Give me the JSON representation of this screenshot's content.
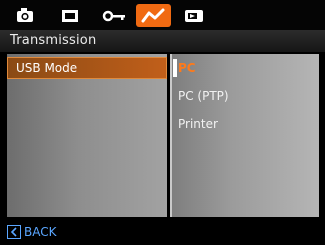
{
  "tabs": [
    {
      "icon": "camera-icon",
      "active": false
    },
    {
      "icon": "memory-card-icon",
      "active": false
    },
    {
      "icon": "key-icon",
      "active": false
    },
    {
      "icon": "connection-icon",
      "active": true
    },
    {
      "icon": "playback-icon",
      "active": false
    }
  ],
  "section": {
    "title": "Transmission"
  },
  "menu": {
    "items": [
      {
        "label": "USB Mode",
        "selected": true
      }
    ]
  },
  "options": {
    "items": [
      {
        "label": "PC",
        "selected": true
      },
      {
        "label": "PC (PTP)",
        "selected": false
      },
      {
        "label": "Printer",
        "selected": false
      }
    ]
  },
  "footer": {
    "back_label": "BACK"
  },
  "colors": {
    "accent": "#f06a12",
    "back": "#5aa6ff"
  }
}
